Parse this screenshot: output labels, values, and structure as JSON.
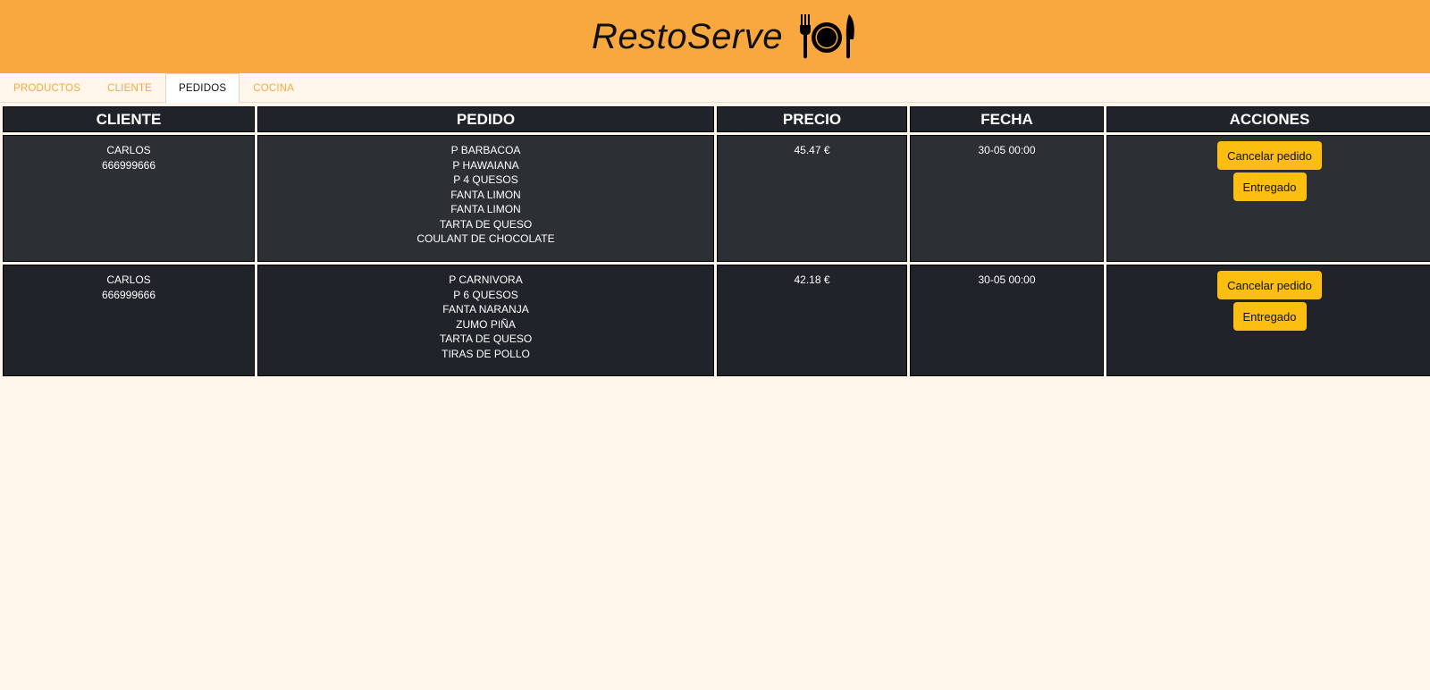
{
  "header": {
    "title": "RestoServe",
    "logo_icon": "plate-fork-knife-icon",
    "background": "#f9a83f"
  },
  "tabs": [
    {
      "label": "PRODUCTOS",
      "active": false
    },
    {
      "label": "CLIENTE",
      "active": false
    },
    {
      "label": "PEDIDOS",
      "active": true
    },
    {
      "label": "COCINA",
      "active": false
    }
  ],
  "table": {
    "columns": [
      "CLIENTE",
      "PEDIDO",
      "PRECIO",
      "FECHA",
      "ACCIONES"
    ],
    "rows": [
      {
        "client_name": "CARLOS",
        "client_phone": "666999666",
        "items": [
          "P BARBACOA",
          "P HAWAIANA",
          "P 4 QUESOS",
          "FANTA LIMON",
          "FANTA LIMON",
          "TARTA DE QUESO",
          "COULANT DE CHOCOLATE"
        ],
        "price": "45.47 €",
        "date": "30-05 00:00",
        "actions": [
          "Cancelar pedido",
          "Entregado"
        ]
      },
      {
        "client_name": "CARLOS",
        "client_phone": "666999666",
        "items": [
          "P CARNIVORA",
          "P 6 QUESOS",
          "FANTA NARANJA",
          "ZUMO PIÑA",
          "TARTA DE QUESO",
          "TIRAS DE POLLO"
        ],
        "price": "42.18 €",
        "date": "30-05 00:00",
        "actions": [
          "Cancelar pedido",
          "Entregado"
        ]
      }
    ]
  },
  "colors": {
    "accent": "#f9a83f",
    "button": "#fbbe11",
    "row_dark": "#202329",
    "row_alt": "#2c2f34",
    "page_bg": "#fff7ec"
  }
}
